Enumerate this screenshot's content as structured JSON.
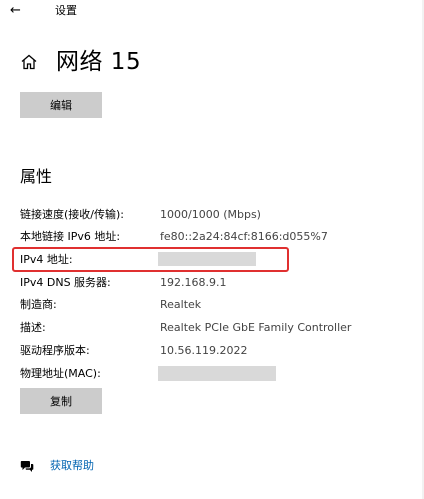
{
  "window": {
    "back_glyph": "←",
    "title": "设置"
  },
  "header": {
    "icon": "home-icon",
    "title": "网络 15"
  },
  "edit_button": {
    "label": "编辑"
  },
  "properties": {
    "section_title": "属性",
    "rows": [
      {
        "label": "链接速度(接收/传输):",
        "value": "1000/1000 (Mbps)"
      },
      {
        "label": "本地链接 IPv6 地址:",
        "value": "fe80::2a24:84cf:8166:d055%7"
      },
      {
        "label": "IPv4 地址:",
        "value": ""
      },
      {
        "label": "IPv4 DNS 服务器:",
        "value": "192.168.9.1"
      },
      {
        "label": "制造商:",
        "value": "Realtek"
      },
      {
        "label": "描述:",
        "value": "Realtek PCIe GbE Family Controller"
      },
      {
        "label": "驱动程序版本:",
        "value": "10.56.119.2022"
      },
      {
        "label": "物理地址(MAC):",
        "value": ""
      }
    ]
  },
  "copy_button": {
    "label": "复制"
  },
  "help": {
    "icon": "help-chat-icon",
    "label": "获取帮助"
  },
  "colors": {
    "highlight": "#e03030",
    "link": "#0063b1",
    "button_bg": "#cccccc",
    "redacted": "#d9d9d9"
  }
}
